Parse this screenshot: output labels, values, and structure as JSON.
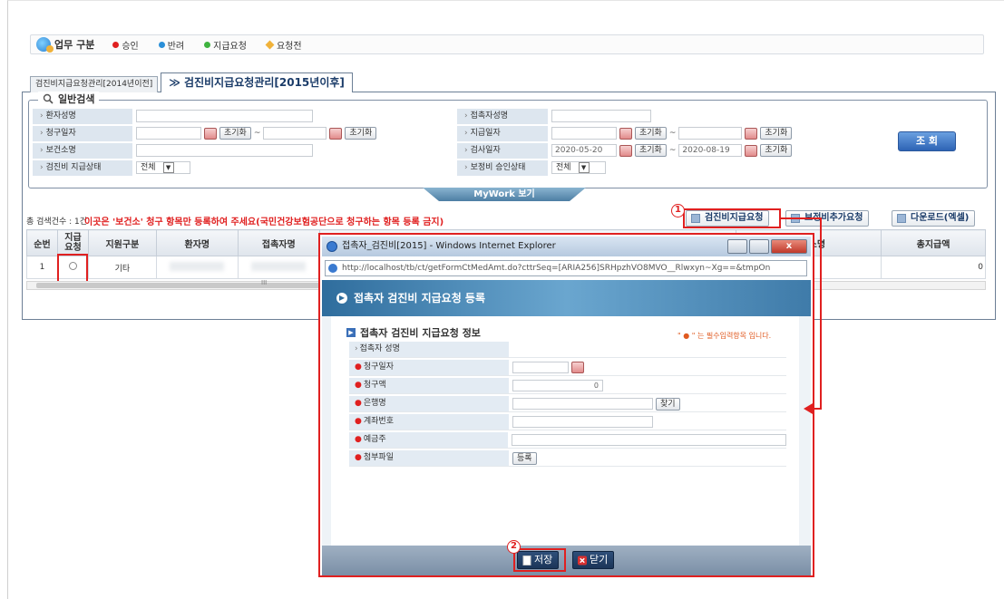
{
  "legend": {
    "title": "업무 구분",
    "items": [
      {
        "label": "승인",
        "color": "#e02020"
      },
      {
        "label": "반려",
        "color": "#2a8fd8"
      },
      {
        "label": "지급요청",
        "color": "#3fb33f"
      },
      {
        "label": "요청전",
        "color": "#f0b23a"
      }
    ]
  },
  "tabs": [
    "검진비지급요청관리[2014년이전]",
    "≫ 검진비지급요청관리[2015년이후]"
  ],
  "search": {
    "title": "일반검색",
    "patient_name": "환자성명",
    "contact_name": "접촉자성명",
    "claim_date": "청구일자",
    "pay_date": "지급일자",
    "health_center": "보건소명",
    "exam_date": "검사일자",
    "exam_from": "2020-05-20",
    "exam_to": "2020-08-19",
    "pay_status": "검진비 지급상태",
    "subsidy_status": "보정비 승인상태",
    "all_option": "전체",
    "reset": "초기화",
    "tilde": "~",
    "query_button": "조 회",
    "mywork": "MyWork 보기"
  },
  "results": {
    "count": "총 검색건수 : 1건",
    "notice": "이곳은 '보건소' 청구 항목만 등록하여 주세요(국민건강보험공단으로 청구하는 항목 등록 금지)",
    "btn_request": "검진비지급요청",
    "btn_extra": "보정비추가요청",
    "btn_download": "다운로드(엑셀)",
    "badge1": "1",
    "badge2": "2",
    "columns": [
      "순번",
      "지급\n요청",
      "지원구분",
      "환자명",
      "접촉자명",
      "보건소명",
      "총지급액"
    ],
    "row": {
      "no": "1",
      "type": "기타",
      "total": "0"
    },
    "scroll_mark": "III"
  },
  "popup": {
    "window_title": "접촉자_검진비[2015] - Windows Internet Explorer",
    "url": "http://localhost/tb/ct/getFormCtMedAmt.do?cttrSeq=[ARIA256]SRHpzhVO8MVO__Rlwxyn~Xg==&tmpOn",
    "header": "접촉자 검진비 지급요청 등록",
    "section": "접촉자 검진비 지급요청 정보",
    "required_note": "\" ● \" 는 필수입력항목 입니다.",
    "fields": {
      "contact_name": "접촉자 성명",
      "claim_date": "청구일자",
      "claim_amount": "청구액",
      "claim_amount_value": "0",
      "bank": "은행명",
      "find": "찾기",
      "account": "계좌번호",
      "holder": "예금주",
      "attach": "첨부파일",
      "register": "등록"
    },
    "save": "저장",
    "close": "닫기"
  }
}
